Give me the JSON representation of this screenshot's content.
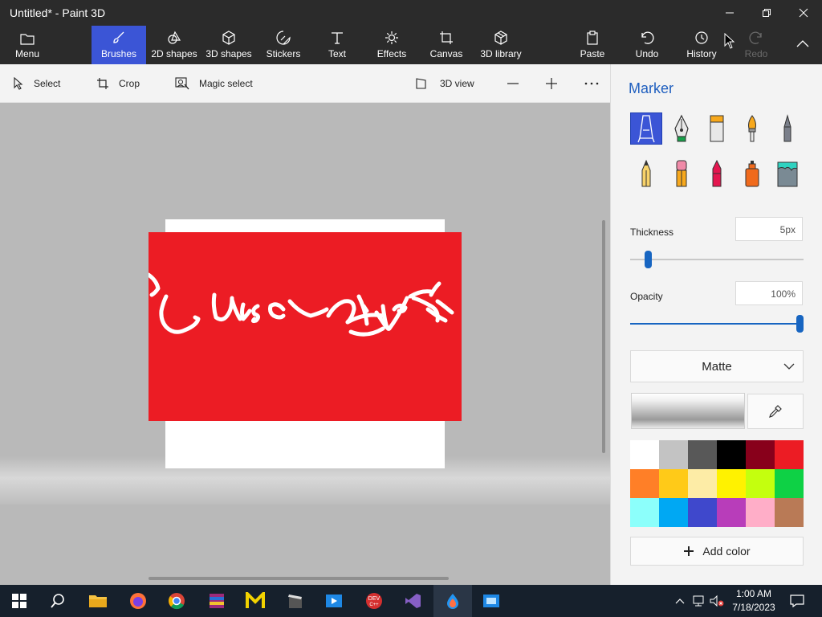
{
  "window": {
    "title": "Untitled* - Paint 3D"
  },
  "ribbon": {
    "menu": "Menu",
    "tabs": [
      "Brushes",
      "2D shapes",
      "3D shapes",
      "Stickers",
      "Text",
      "Effects",
      "Canvas",
      "3D library"
    ],
    "active_tab": "Brushes",
    "right": {
      "paste": "Paste",
      "undo": "Undo",
      "history": "History",
      "redo": "Redo"
    }
  },
  "toolbar": {
    "select": "Select",
    "crop": "Crop",
    "magic_select": "Magic select",
    "view3d": "3D view"
  },
  "canvas": {
    "scribble_text": "SunScapet"
  },
  "panel": {
    "title": "Marker",
    "brushes": [
      {
        "name": "marker",
        "selected": true
      },
      {
        "name": "calligraphy-pen",
        "selected": false
      },
      {
        "name": "oil-brush",
        "selected": false
      },
      {
        "name": "watercolor",
        "selected": false
      },
      {
        "name": "pixel-pen",
        "selected": false
      },
      {
        "name": "pencil",
        "selected": false
      },
      {
        "name": "eraser",
        "selected": false
      },
      {
        "name": "crayon",
        "selected": false
      },
      {
        "name": "spray-can",
        "selected": false
      },
      {
        "name": "fill",
        "selected": false
      }
    ],
    "thickness": {
      "label": "Thickness",
      "value": "5px",
      "level": 0.05
    },
    "opacity": {
      "label": "Opacity",
      "value": "100%",
      "level": 1.0
    },
    "finish": "Matte",
    "palette": [
      "#ffffff",
      "#c3c3c3",
      "#585858",
      "#000000",
      "#88001b",
      "#ec1c24",
      "#ff7f27",
      "#ffca18",
      "#fdeca6",
      "#fff200",
      "#c4ff0e",
      "#0ed145",
      "#8cfffb",
      "#00a8f3",
      "#3f48cc",
      "#b83dba",
      "#ffaec8",
      "#b97a56"
    ],
    "add_color": "Add color"
  },
  "taskbar": {
    "time": "1:00 AM",
    "date": "7/18/2023"
  },
  "colors": {
    "accent": "#3b55d6",
    "canvas_red": "#ec1c24",
    "link": "#1f5fbf"
  }
}
